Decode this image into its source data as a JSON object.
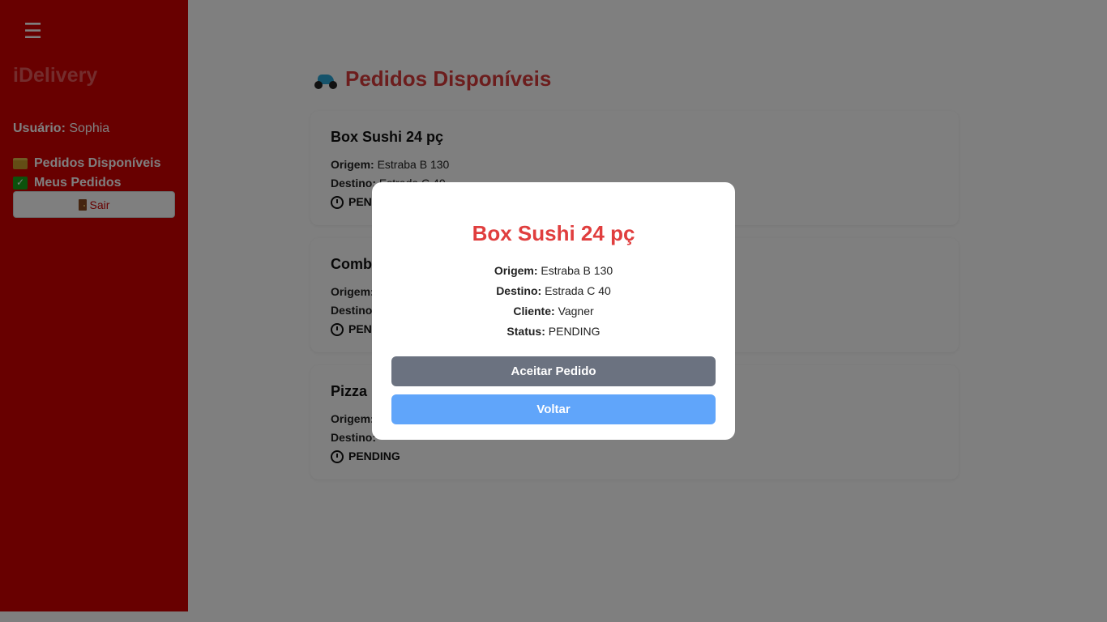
{
  "sidebar": {
    "menu_icon": "☰",
    "brand": "iDelivery",
    "user_label": "Usuário:",
    "user_name": "Sophia",
    "nav": [
      {
        "label": "Pedidos Disponíveis",
        "icon": "folder-icon"
      },
      {
        "label": "Meus Pedidos",
        "icon": "check-icon"
      }
    ],
    "logout_label": "Sair"
  },
  "main": {
    "title": "Pedidos Disponíveis",
    "cards": [
      {
        "title": "Box Sushi 24 pç",
        "origem_label": "Origem:",
        "origem": "Estraba B 130",
        "destino_label": "Destino:",
        "destino": "Estrada C 40",
        "status": "PENDING"
      },
      {
        "title": "Comb",
        "origem_label": "Origem:",
        "destino_label": "Destino",
        "status": "PEN"
      },
      {
        "title": "Pizza",
        "origem_label": "Origem:",
        "destino_label": "Destino:",
        "status": "PENDING"
      }
    ]
  },
  "modal": {
    "title": "Box Sushi 24 pç",
    "origem_label": "Origem:",
    "origem": "Estraba B 130",
    "destino_label": "Destino:",
    "destino": "Estrada C 40",
    "cliente_label": "Cliente:",
    "cliente": "Vagner",
    "status_label": "Status:",
    "status": "PENDING",
    "accept_label": "Aceitar Pedido",
    "back_label": "Voltar"
  },
  "colors": {
    "sidebar": "#d00000",
    "accent_red": "#e03e3e",
    "accept_button": "#6b7280",
    "back_button": "#60a5fa"
  }
}
